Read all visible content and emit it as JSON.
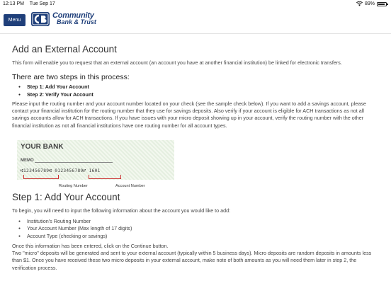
{
  "status_bar": {
    "time": "12:13 PM",
    "date": "Tue Sep 17",
    "battery": "89%",
    "battery_level": 0.89
  },
  "header": {
    "menu_label": "Menu",
    "logo_line1": "Community",
    "logo_line2": "Bank & Trust",
    "brand_color": "#1f3f7a"
  },
  "page": {
    "title": "Add an External Account",
    "intro": "This form will enable you to request that an external account (an account you have at another financial institution) be linked for electronic transfers.",
    "steps_heading": "There are two steps in this process:",
    "steps": [
      "Step 1: Add Your Account",
      "Step 2: Verify Your Account"
    ],
    "instructions": "Please input the routing number and your account number located on your check (see the sample check below). If you want to add a savings account, please contact your financial institution for the routing number that they use for savings deposits. Also verify if your account is eligible for ACH transactions as not all savings accounts allow for ACH transactions. If you have issues with your micro deposit showing up in your account, verify the routing number with the other financial institution as not all financial institutions have one routing number for all account types."
  },
  "check": {
    "bank_name": "YOUR BANK",
    "memo": "MEMO",
    "micr": "⑆123456789⑆ 0123456789⑈ 1601",
    "routing_label": "Routing Number",
    "account_label": "Account Number"
  },
  "step1": {
    "title": "Step 1: Add Your Account",
    "lead": "To begin, you will need to input the following information about the account you would like to add:",
    "items": [
      "Institution's Routing Number",
      "Your Account Number (Max length of 17 digits)",
      "Account Type (checking or savings)"
    ],
    "continue_text": "Once this information has been entered, click on the Continue button.",
    "micro_text": "Two \"micro\" deposits will be generated and sent to your external account (typically within 5 business days). Micro deposits are random deposits in amounts less than $1. Once you have received these two micro deposits in your external account, make note of both amounts as you will need them later in step 2, the verification process."
  }
}
